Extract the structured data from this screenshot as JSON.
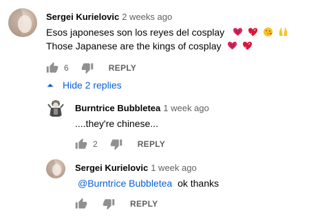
{
  "comment": {
    "author": "Sergei Kurielovic",
    "time": "2 weeks ago",
    "line1": "Esos japoneses son los reyes del cosplay",
    "line2": "Those Japanese are the kings of cosplay",
    "line1_emojis": [
      "heart-face-icon",
      "heart-icon",
      "kiss-face-icon",
      "raised-hands-icon"
    ],
    "line2_emojis": [
      "heart-face-icon",
      "heart-icon"
    ],
    "like_count": "6",
    "reply_label": "REPLY"
  },
  "replies_toggle": {
    "label": "Hide 2 replies"
  },
  "replies": [
    {
      "author": "Burntrice Bubbletea",
      "time": "1 week ago",
      "text": "....they're chinese...",
      "like_count": "2",
      "reply_label": "REPLY"
    },
    {
      "author": "Sergei Kurielovic",
      "time": "1 week ago",
      "mention": "@Burntrice Bubbletea",
      "text": "ok thanks",
      "reply_label": "REPLY"
    }
  ],
  "colors": {
    "link": "#065fd4",
    "secondary_text": "#606060",
    "primary_text": "#030303"
  }
}
